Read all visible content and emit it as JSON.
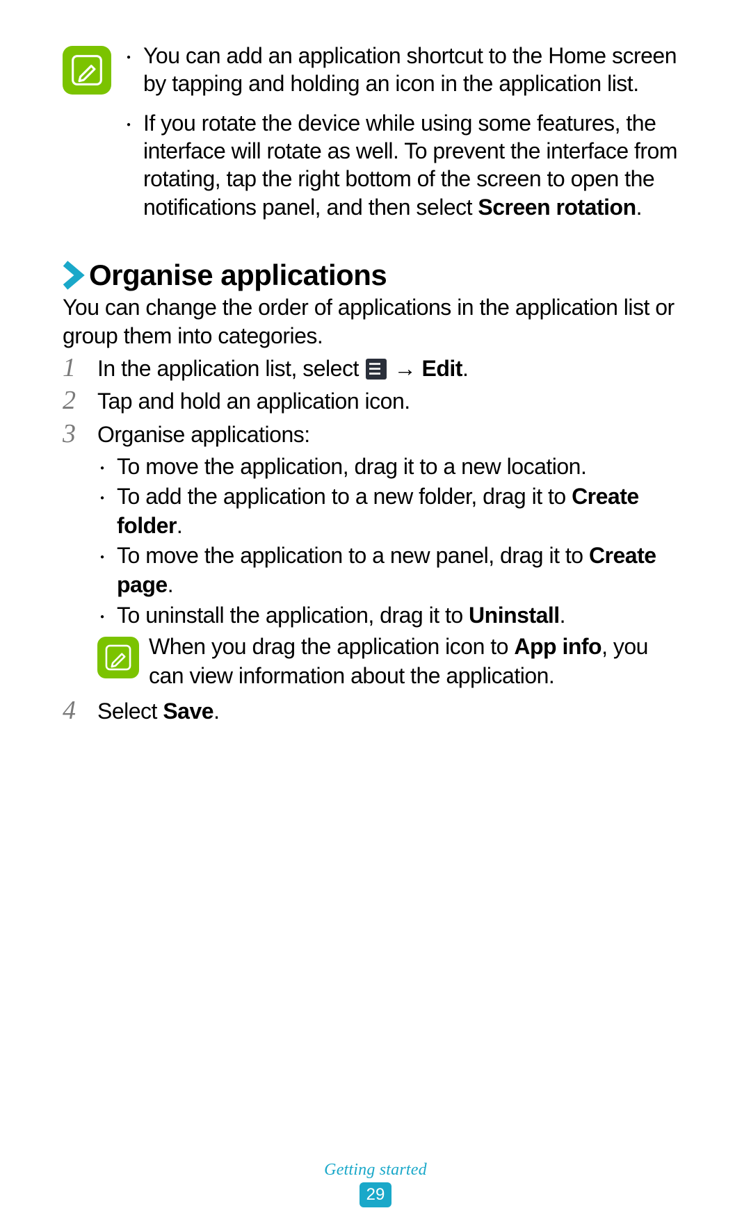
{
  "note1": {
    "bullet1": "You can add an application shortcut to the Home screen by tapping and holding an icon in the application list.",
    "bullet2_pre": "If you rotate the device while using some features, the interface will rotate as well. To prevent the interface from rotating, tap the right bottom of the screen to open the notifications panel, and then select ",
    "bullet2_bold": "Screen rotation",
    "bullet2_post": "."
  },
  "section": {
    "title": "Organise applications",
    "intro": "You can change the order of applications in the application list or group them into categories."
  },
  "steps": {
    "s1_pre": "In the application list, select ",
    "s1_arrow": " → ",
    "s1_bold": "Edit",
    "s1_post": ".",
    "s2": "Tap and hold an application icon.",
    "s3_title": "Organise applications:",
    "s3_b1": "To move the application, drag it to a new location.",
    "s3_b2_pre": "To add the application to a new folder, drag it to ",
    "s3_b2_bold": "Create folder",
    "s3_b2_post": ".",
    "s3_b3_pre": "To move the application to a new panel, drag it to ",
    "s3_b3_bold": "Create page",
    "s3_b3_post": ".",
    "s3_b4_pre": "To uninstall the application, drag it to ",
    "s3_b4_bold": "Uninstall",
    "s3_b4_post": ".",
    "s3_note_pre": "When you drag the application icon to ",
    "s3_note_bold": "App info",
    "s3_note_post": ", you can view information about the application.",
    "s4_pre": "Select ",
    "s4_bold": "Save",
    "s4_post": "."
  },
  "nums": {
    "n1": "1",
    "n2": "2",
    "n3": "3",
    "n4": "4"
  },
  "footer": {
    "section": "Getting started",
    "page": "29"
  }
}
